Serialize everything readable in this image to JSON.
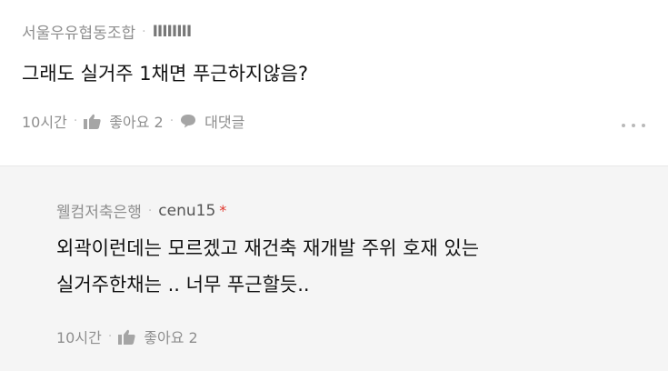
{
  "comment": {
    "author": "서울우유협동조합",
    "masked_id": "IIIIIIII",
    "text": "그래도 실거주 1채면 푸근하지않음?",
    "time": "10시간",
    "like_label": "좋아요 2",
    "reply_label": "대댓글"
  },
  "reply": {
    "author": "웰컴저축은행",
    "user_id": "cenu15",
    "badge": "*",
    "lines": [
      "외곽이런데는 모르겠고 재건축 재개발 주위 호재 있는",
      "실거주한채는 .. 너무 푸근할듯.."
    ],
    "time": "10시간",
    "like_label": "좋아요 2"
  },
  "icons": {
    "like": "thumbs-up-icon",
    "reply": "speech-bubble-icon",
    "more": "more-options-icon"
  },
  "colors": {
    "meta": "#8e8e8e",
    "badge": "#e0352b",
    "reply_bg": "#f5f5f5"
  }
}
